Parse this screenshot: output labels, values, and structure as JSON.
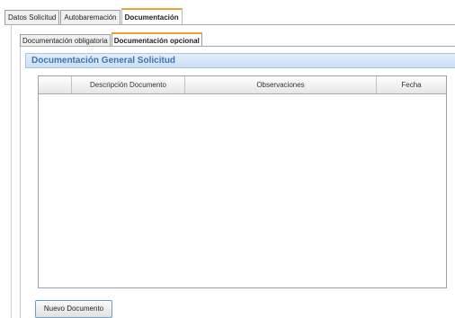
{
  "top_tabs": [
    {
      "label": "Datos Solicitud",
      "active": false
    },
    {
      "label": "Autobaremación",
      "active": false
    },
    {
      "label": "Documentación",
      "active": true
    }
  ],
  "inner_tabs": [
    {
      "label": "Documentación obligatoria",
      "active": false
    },
    {
      "label": "Documentación opcional",
      "active": true
    }
  ],
  "section": {
    "title": "Documentación General Solicitud"
  },
  "grid": {
    "columns": [
      "",
      "Descripción Documento",
      "Observaciones",
      "Fecha"
    ],
    "rows": []
  },
  "actions": {
    "new_document_label": "Nuevo Documento"
  },
  "colors": {
    "active_tab_accent": "#f0a030",
    "section_title": "#3f73b0",
    "section_bg": "#cadff3",
    "button_border": "#6aa0c8"
  }
}
